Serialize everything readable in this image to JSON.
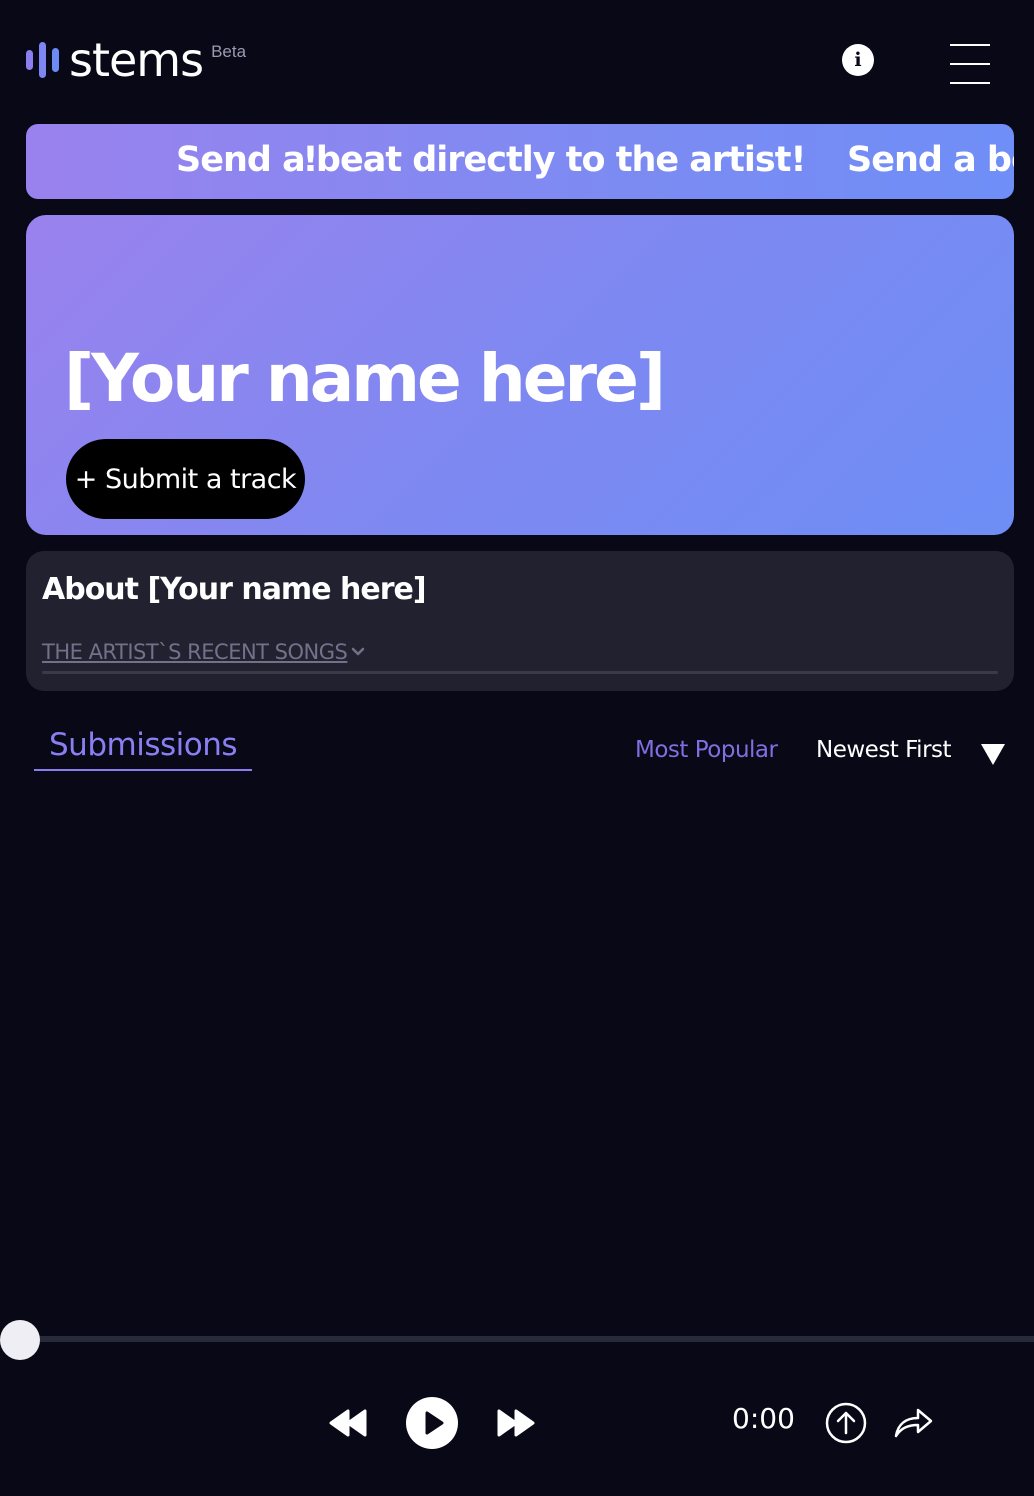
{
  "header": {
    "logo_text": "stems",
    "beta_label": "Beta"
  },
  "banner": {
    "fragment": "!",
    "message": "Send a beat directly to the artist!",
    "message_repeat": "Send a be"
  },
  "hero": {
    "artist_name": "[Your name here]",
    "submit_label": "+ Submit a track"
  },
  "about": {
    "title": "About [Your name here]",
    "recent_songs_label": "THE ARTIST`S RECENT SONGS"
  },
  "submissions": {
    "tab_label": "Submissions",
    "sort_options": [
      "Most Popular",
      "Newest First"
    ]
  },
  "player": {
    "time": "0:00",
    "progress": 0
  },
  "colors": {
    "background": "#080816",
    "accent": "#8a7ff2",
    "gradient_start": "#9a82ee",
    "gradient_end": "#6d8ef6"
  },
  "icons": {
    "info": "info-icon",
    "menu": "hamburger-menu-icon",
    "sort": "triangle-down-icon",
    "rewind": "rewind-icon",
    "play": "play-icon",
    "forward": "fast-forward-icon",
    "upload": "upload-icon",
    "share": "share-icon"
  }
}
